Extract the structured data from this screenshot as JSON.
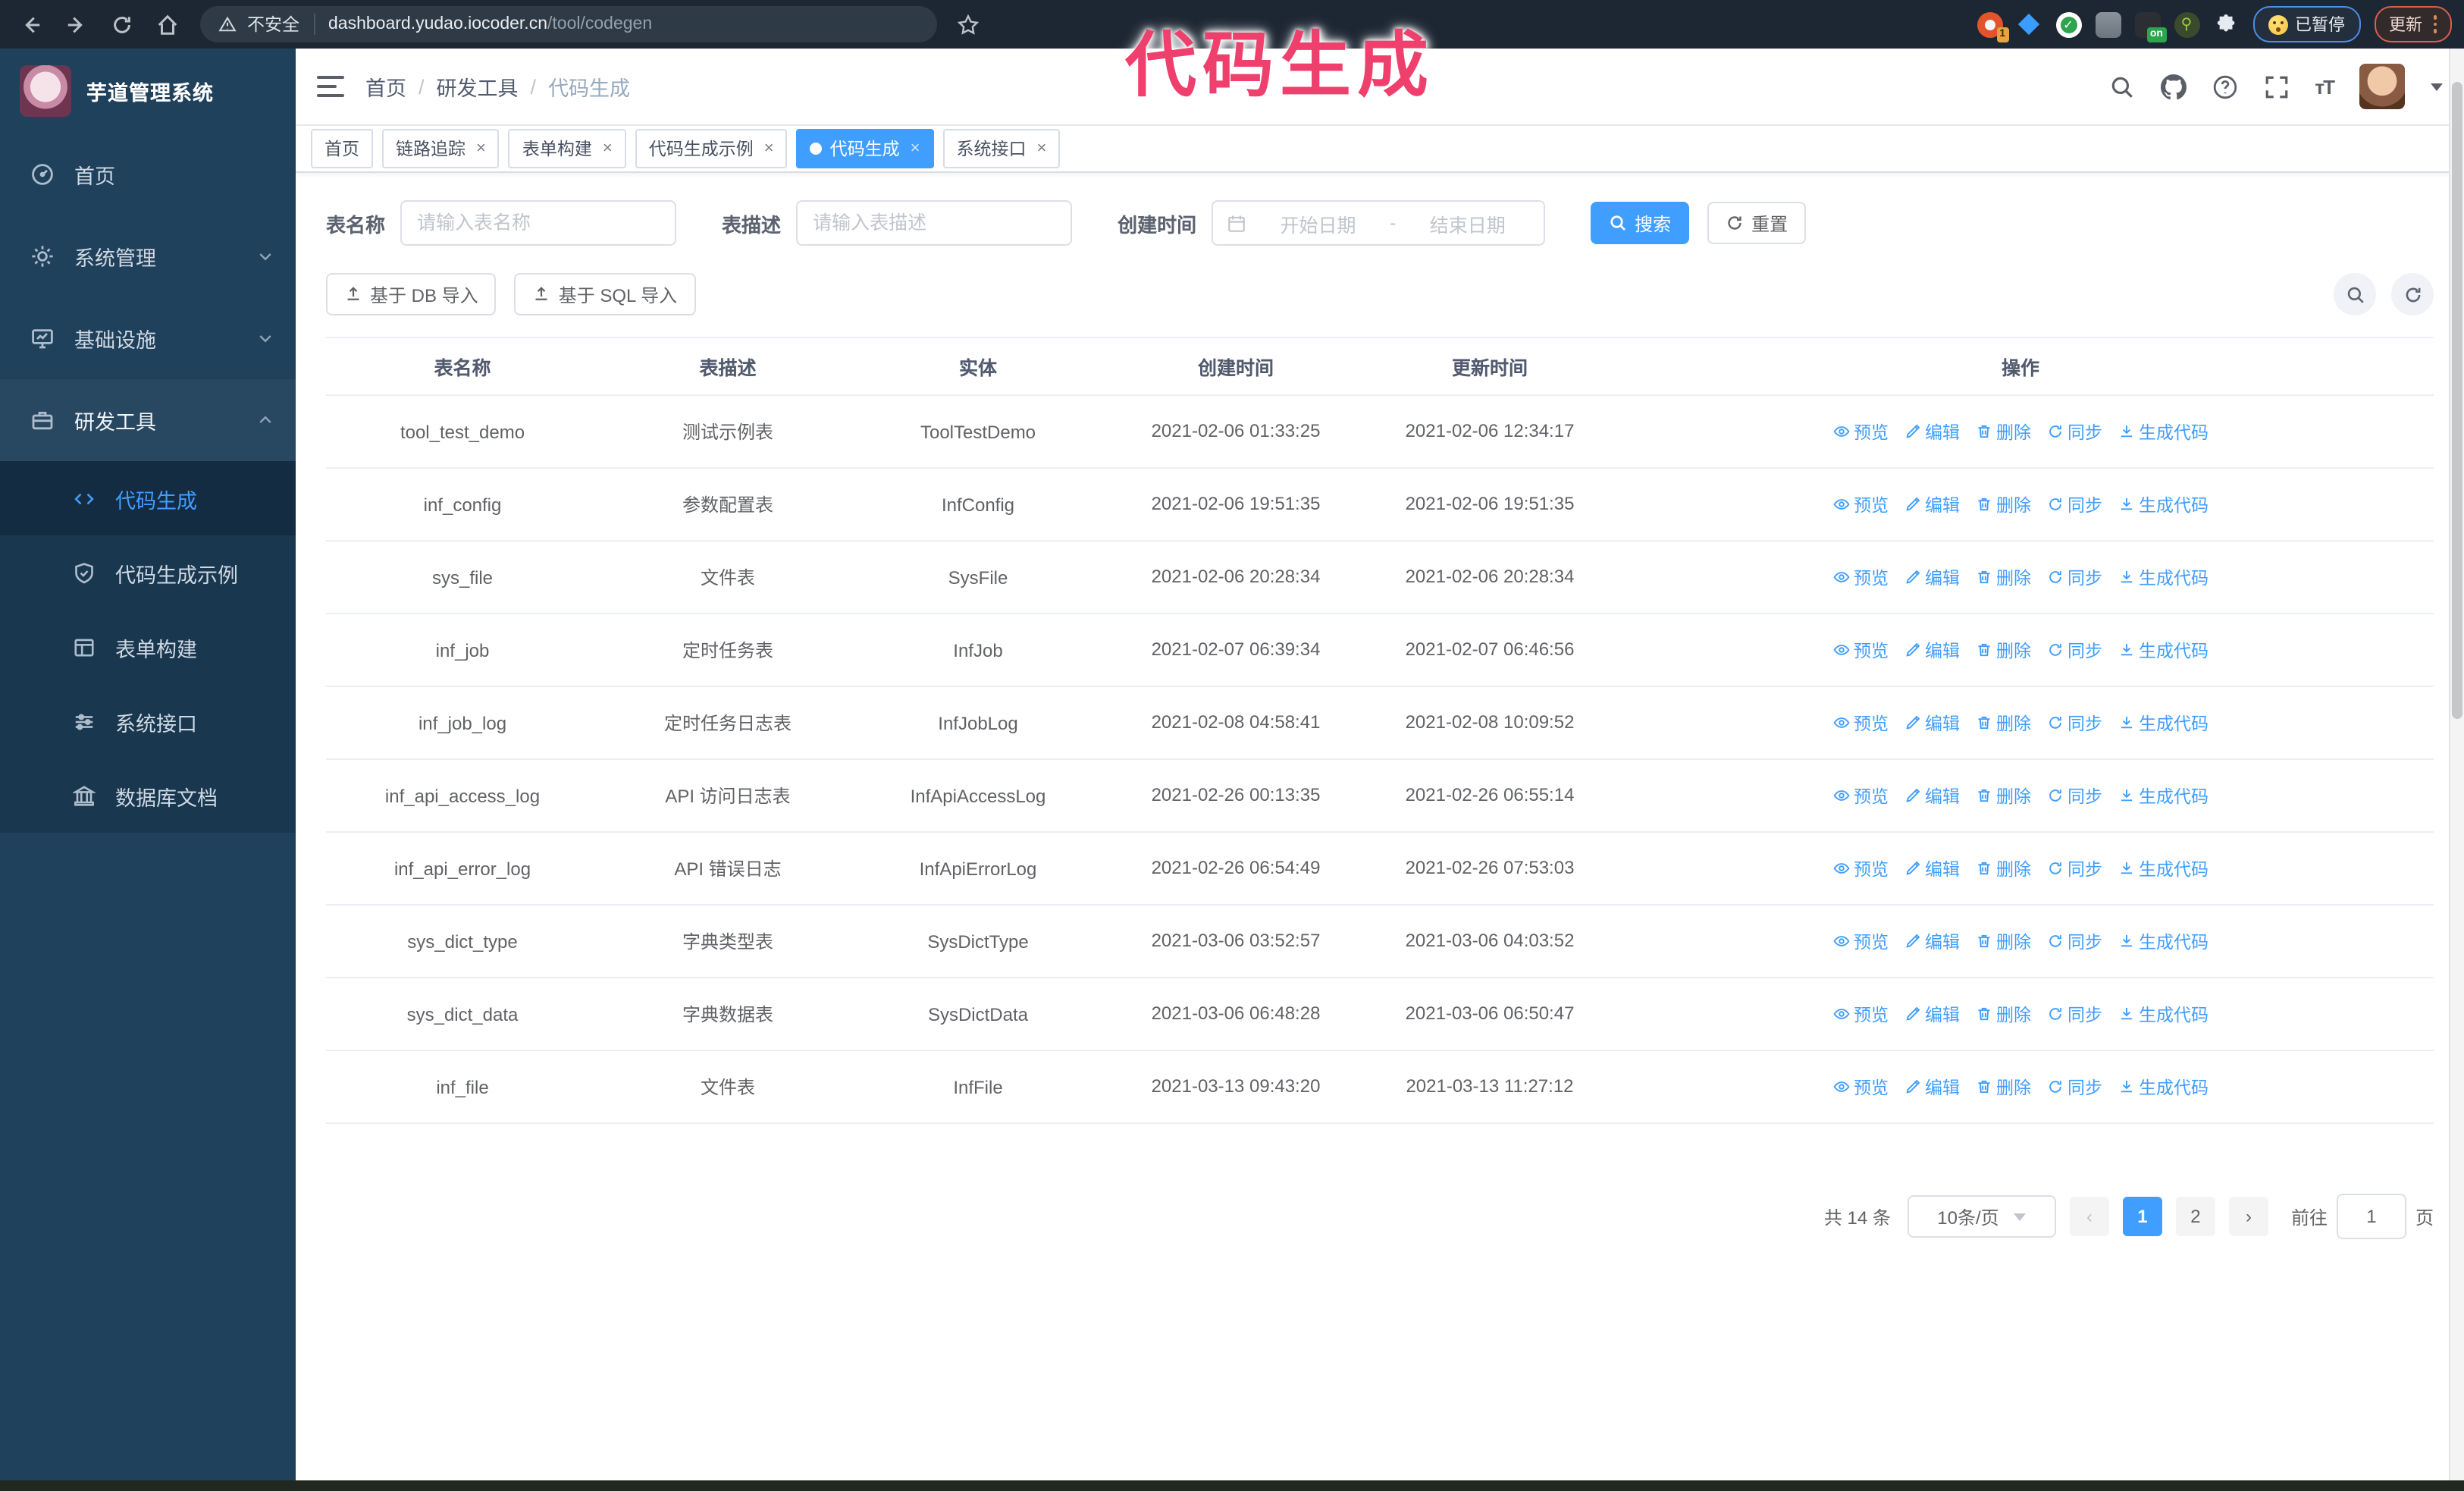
{
  "colors": {
    "accent": "#409EFF",
    "link": "#409EFF",
    "chrome_bg": "#1d2733",
    "sidebar_bg": "#20415c",
    "submenu_bg": "#1a3750",
    "submenu_active_bg": "#142c42",
    "annotation": "#ee3f6d"
  },
  "annotation": "代码生成",
  "browser": {
    "security_label": "不安全",
    "url_host": "dashboard.yudao.iocoder.cn",
    "url_path": "/tool/codegen",
    "paused_badge": "已暂停",
    "update_button": "更新",
    "extension_badge": "1",
    "extension_on_badge": "on"
  },
  "sidebar": {
    "logo_title": "芋道管理系统",
    "items": [
      {
        "label": "首页",
        "icon": "dashboard"
      },
      {
        "label": "系统管理",
        "icon": "gear",
        "chevron": "down"
      },
      {
        "label": "基础设施",
        "icon": "monitor",
        "chevron": "down"
      },
      {
        "label": "研发工具",
        "icon": "tool",
        "chevron": "up",
        "expanded": true
      }
    ],
    "submenu": [
      {
        "label": "代码生成",
        "icon": "code",
        "active": true
      },
      {
        "label": "代码生成示例",
        "icon": "shield"
      },
      {
        "label": "表单构建",
        "icon": "form"
      },
      {
        "label": "系统接口",
        "icon": "sliders"
      },
      {
        "label": "数据库文档",
        "icon": "db"
      }
    ]
  },
  "breadcrumb": [
    "首页",
    "研发工具",
    "代码生成"
  ],
  "tabs": [
    {
      "label": "首页",
      "closable": false,
      "active": false
    },
    {
      "label": "链路追踪",
      "closable": true,
      "active": false
    },
    {
      "label": "表单构建",
      "closable": true,
      "active": false
    },
    {
      "label": "代码生成示例",
      "closable": true,
      "active": false
    },
    {
      "label": "代码生成",
      "closable": true,
      "active": true
    },
    {
      "label": "系统接口",
      "closable": true,
      "active": false
    }
  ],
  "search_form": {
    "name_label": "表名称",
    "name_placeholder": "请输入表名称",
    "desc_label": "表描述",
    "desc_placeholder": "请输入表描述",
    "time_label": "创建时间",
    "start_placeholder": "开始日期",
    "range_separator": "-",
    "end_placeholder": "结束日期",
    "search_label": "搜索",
    "reset_label": "重置"
  },
  "toolbar": {
    "import_db_label": "基于 DB 导入",
    "import_sql_label": "基于 SQL 导入"
  },
  "table": {
    "columns": [
      "表名称",
      "表描述",
      "实体",
      "创建时间",
      "更新时间",
      "操作"
    ],
    "actions": [
      "预览",
      "编辑",
      "删除",
      "同步",
      "生成代码"
    ],
    "rows": [
      {
        "name": "tool_test_demo",
        "desc": "测试示例表",
        "entity": "ToolTestDemo",
        "created": "2021-02-06 01:33:25",
        "updated": "2021-02-06 12:34:17"
      },
      {
        "name": "inf_config",
        "desc": "参数配置表",
        "entity": "InfConfig",
        "created": "2021-02-06 19:51:35",
        "updated": "2021-02-06 19:51:35"
      },
      {
        "name": "sys_file",
        "desc": "文件表",
        "entity": "SysFile",
        "created": "2021-02-06 20:28:34",
        "updated": "2021-02-06 20:28:34"
      },
      {
        "name": "inf_job",
        "desc": "定时任务表",
        "entity": "InfJob",
        "created": "2021-02-07 06:39:34",
        "updated": "2021-02-07 06:46:56"
      },
      {
        "name": "inf_job_log",
        "desc": "定时任务日志表",
        "entity": "InfJobLog",
        "created": "2021-02-08 04:58:41",
        "updated": "2021-02-08 10:09:52"
      },
      {
        "name": "inf_api_access_log",
        "desc": "API 访问日志表",
        "entity": "InfApiAccessLog",
        "created": "2021-02-26 00:13:35",
        "updated": "2021-02-26 06:55:14"
      },
      {
        "name": "inf_api_error_log",
        "desc": "API 错误日志",
        "entity": "InfApiErrorLog",
        "created": "2021-02-26 06:54:49",
        "updated": "2021-02-26 07:53:03"
      },
      {
        "name": "sys_dict_type",
        "desc": "字典类型表",
        "entity": "SysDictType",
        "created": "2021-03-06 03:52:57",
        "updated": "2021-03-06 04:03:52"
      },
      {
        "name": "sys_dict_data",
        "desc": "字典数据表",
        "entity": "SysDictData",
        "created": "2021-03-06 06:48:28",
        "updated": "2021-03-06 06:50:47"
      },
      {
        "name": "inf_file",
        "desc": "文件表",
        "entity": "InfFile",
        "created": "2021-03-13 09:43:20",
        "updated": "2021-03-13 11:27:12"
      }
    ]
  },
  "pagination": {
    "total": "共 14 条",
    "page_size": "10条/页",
    "pages": [
      "1",
      "2"
    ],
    "active_page": "1",
    "goto_label": "前往",
    "goto_value": "1",
    "page_unit": "页"
  }
}
